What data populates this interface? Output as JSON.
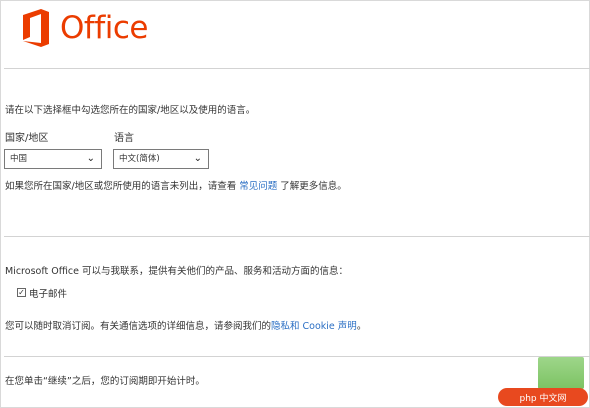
{
  "brand": {
    "name": "Office",
    "color": "#eb3c00"
  },
  "region": {
    "instruction": "请在以下选择框中勾选您所在的国家/地区以及使用的语言。",
    "country_label": "国家/地区",
    "country_value": "中国",
    "language_label": "语言",
    "language_value": "中文(简体)",
    "faq_prefix": "如果您所在国家/地区或您所使用的语言未列出，请查看",
    "faq_link": "常见问题",
    "faq_suffix": "了解更多信息。"
  },
  "subscribe": {
    "intro": "Microsoft Office 可以与我联系，提供有关他们的产品、服务和活动方面的信息：",
    "email_label": "电子邮件",
    "email_checked": true,
    "privacy_prefix": "您可以随时取消订阅。有关通信选项的详细信息，请参阅我们的",
    "privacy_link": "隐私和 Cookie 声明",
    "privacy_suffix": "。"
  },
  "footer": {
    "note": "在您单击“继续”之后，您的订阅期即开始计时。"
  },
  "watermark": {
    "text": "php 中文网"
  }
}
